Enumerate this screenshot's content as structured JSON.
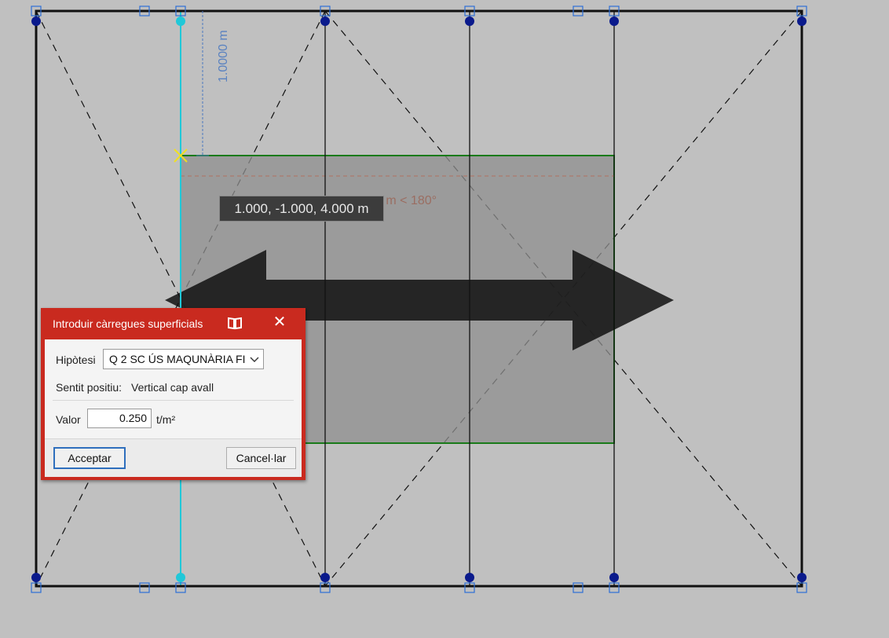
{
  "canvas": {
    "coord_tooltip": "1.000, -1.000, 4.000 m",
    "dim_vertical": "1.0000 m",
    "dim_angle": "3.0000 m < 180°"
  },
  "dialog": {
    "title": "Introduir càrregues superficials",
    "hypothesis_label": "Hipòtesi",
    "hypothesis_value": "Q 2 SC ÚS MAQUNÀRIA FI",
    "direction_label": "Sentit positiu:",
    "direction_value": "Vertical cap avall",
    "value_label": "Valor",
    "value": "0.250",
    "unit": "t/m²",
    "accept_label": "Acceptar",
    "cancel_label": "Cancel·lar"
  },
  "icons": {
    "help": "book-icon",
    "close": "close-icon",
    "dropdown": "chevron-down-icon"
  },
  "colors": {
    "dialog_frame": "#c92a1f",
    "canvas_bg": "#c0c0c0",
    "selected_beam": "#20c8d8",
    "node": "#0a1a8c",
    "load_panel_edge": "#1a7a1a"
  }
}
